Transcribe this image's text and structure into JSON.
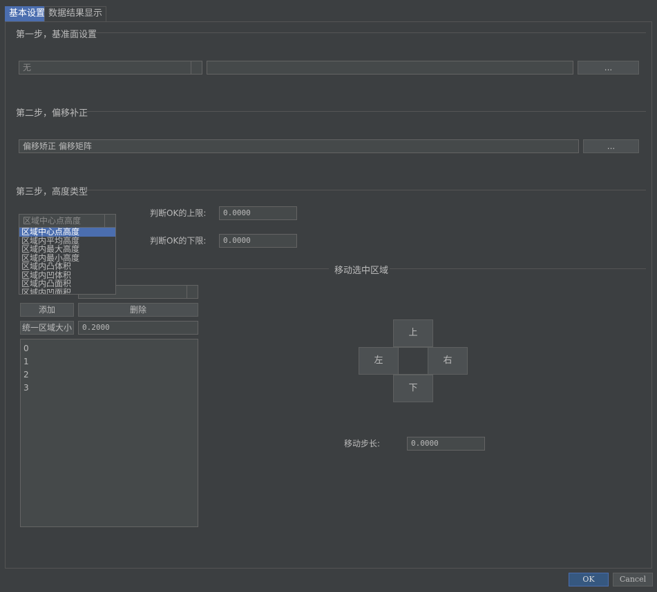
{
  "tabs": [
    {
      "label": "基本设置"
    },
    {
      "label": "数据结果显示"
    }
  ],
  "step1": {
    "title": "第一步，基准面设置",
    "combo_value": "无",
    "path_value": "",
    "browse_label": "..."
  },
  "step2": {
    "title": "第二步，偏移补正",
    "field_value": "偏移矫正   偏移矩阵",
    "browse_label": "..."
  },
  "step3": {
    "title": "第三步，高度类型",
    "combo_value": "区域中心点高度",
    "upper_label": "判断OK的上限:",
    "upper_value": "0.0000",
    "lower_label": "判断OK的下限:",
    "lower_value": "0.0000",
    "dropdown_options": [
      "区域中心点高度",
      "区域内平均高度",
      "区域内最大高度",
      "区域内最小高度",
      "区域内凸体积",
      "区域内凹体积",
      "区域内凸面积",
      "区域内凹面积"
    ]
  },
  "region": {
    "title": "移动选中区域",
    "add_label": "添加",
    "delete_label": "删除",
    "unify_label": "统一区域大小",
    "unify_value": "0.2000",
    "shape_combo_value": "",
    "items": [
      "0",
      "1",
      "2",
      "3"
    ]
  },
  "move": {
    "up": "上",
    "down": "下",
    "left": "左",
    "right": "右",
    "step_label": "移动步长:",
    "step_value": "0.0000"
  },
  "dialog": {
    "ok": "OK",
    "cancel": "Cancel"
  }
}
